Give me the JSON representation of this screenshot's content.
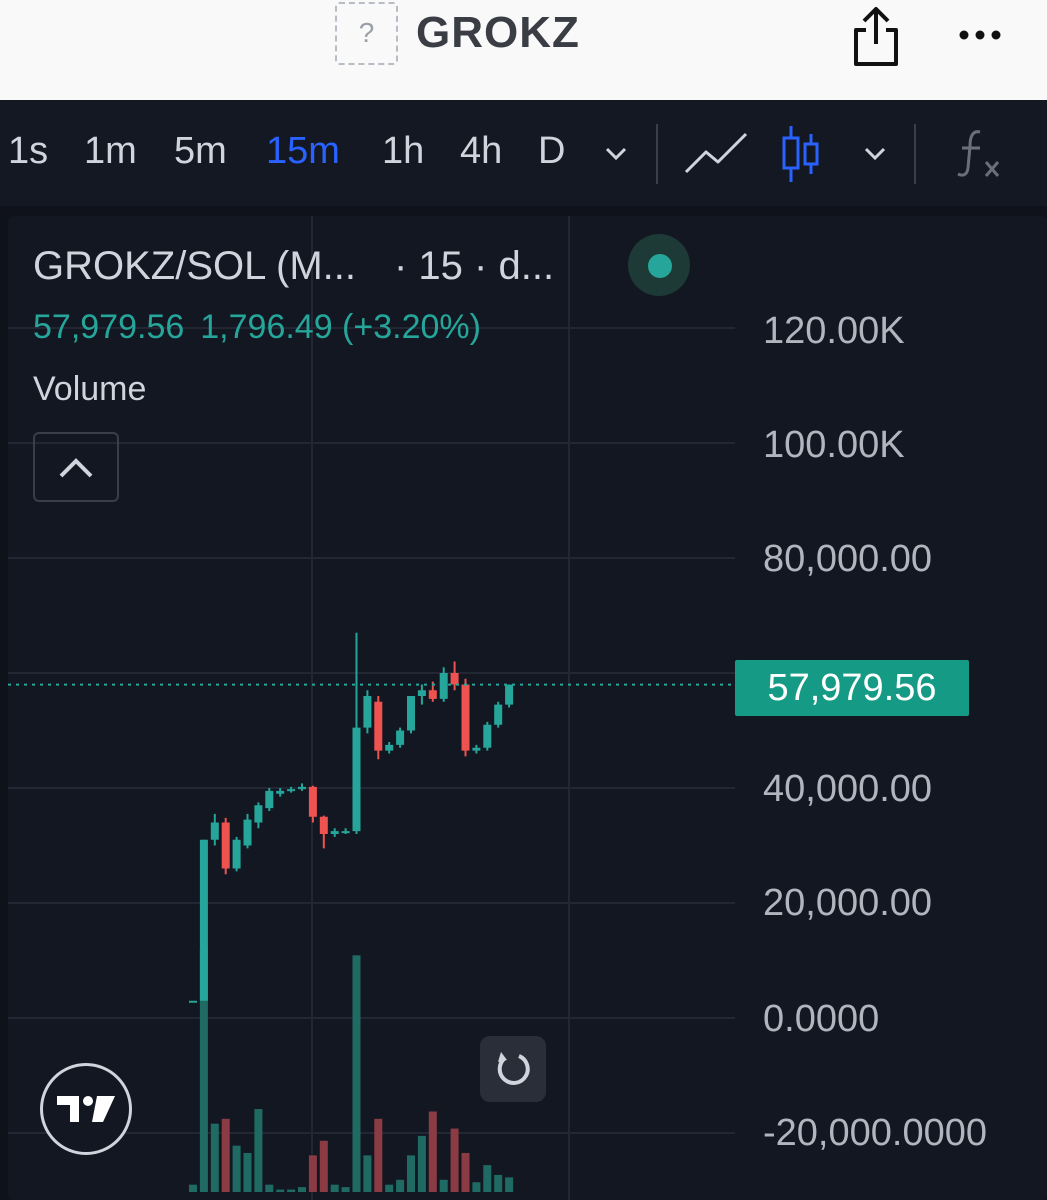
{
  "header": {
    "token_name": "GROKZ",
    "logo_placeholder": "?",
    "share_icon": "share-icon",
    "more_icon": "more-horizontal-icon"
  },
  "toolbar": {
    "timeframes": [
      "1s",
      "1m",
      "5m",
      "15m",
      "1h",
      "4h",
      "D"
    ],
    "active_timeframe": "15m",
    "line_chart_icon": "line-chart-icon",
    "candle_chart_icon": "candlestick-icon",
    "indicators_icon": "fx-icon"
  },
  "legend": {
    "symbol": "GROKZ/SOL (M...",
    "interval": "· 15 · d...",
    "last": "57,979.56",
    "change": "1,796.49 (+3.20%)",
    "volume_label": "Volume"
  },
  "colors": {
    "up": "#26a69a",
    "down": "#ef5350",
    "active_tab": "#2962ff",
    "price_tag": "#159b85"
  },
  "chart_data": {
    "type": "candlestick",
    "y_axis_labels": [
      "120.00K",
      "100.00K",
      "80,000.00",
      "40,000.00",
      "20,000.00",
      "0.0000",
      "-20,000.0000"
    ],
    "current_price_label": "57,979.56",
    "current_price": 57979.56,
    "ylim": [
      -22000,
      130000
    ],
    "candles": [
      {
        "o": 3000,
        "h": 3000,
        "l": 3000,
        "c": 3000
      },
      {
        "o": 3000,
        "h": 31000,
        "l": 3000,
        "c": 31000
      },
      {
        "o": 31000,
        "h": 35500,
        "l": 30000,
        "c": 34000
      },
      {
        "o": 34000,
        "h": 34800,
        "l": 25000,
        "c": 26000
      },
      {
        "o": 26000,
        "h": 31500,
        "l": 25500,
        "c": 31000
      },
      {
        "o": 30000,
        "h": 35500,
        "l": 29500,
        "c": 34500
      },
      {
        "o": 34000,
        "h": 37500,
        "l": 33000,
        "c": 37000
      },
      {
        "o": 36500,
        "h": 40000,
        "l": 36000,
        "c": 39500
      },
      {
        "o": 39000,
        "h": 40000,
        "l": 38500,
        "c": 39500
      },
      {
        "o": 39500,
        "h": 40200,
        "l": 39200,
        "c": 39800
      },
      {
        "o": 39800,
        "h": 40800,
        "l": 39500,
        "c": 40200
      },
      {
        "o": 40200,
        "h": 40400,
        "l": 34000,
        "c": 35000
      },
      {
        "o": 35000,
        "h": 35200,
        "l": 29500,
        "c": 32000
      },
      {
        "o": 32000,
        "h": 33000,
        "l": 31500,
        "c": 32500
      },
      {
        "o": 32500,
        "h": 33000,
        "l": 32000,
        "c": 32500
      },
      {
        "o": 32500,
        "h": 67000,
        "l": 32000,
        "c": 50500
      },
      {
        "o": 50500,
        "h": 57000,
        "l": 49500,
        "c": 56000
      },
      {
        "o": 55000,
        "h": 56000,
        "l": 45000,
        "c": 46500
      },
      {
        "o": 46500,
        "h": 48000,
        "l": 46000,
        "c": 47500
      },
      {
        "o": 47500,
        "h": 50500,
        "l": 47000,
        "c": 50000
      },
      {
        "o": 50000,
        "h": 56000,
        "l": 49500,
        "c": 56000
      },
      {
        "o": 56000,
        "h": 58000,
        "l": 54500,
        "c": 57000
      },
      {
        "o": 57000,
        "h": 58500,
        "l": 55000,
        "c": 55500
      },
      {
        "o": 55500,
        "h": 61000,
        "l": 55000,
        "c": 60000
      },
      {
        "o": 60000,
        "h": 62000,
        "l": 57000,
        "c": 58000
      },
      {
        "o": 58000,
        "h": 59000,
        "l": 45500,
        "c": 46500
      },
      {
        "o": 46500,
        "h": 47500,
        "l": 46000,
        "c": 47000
      },
      {
        "o": 47000,
        "h": 51500,
        "l": 46500,
        "c": 51000
      },
      {
        "o": 51000,
        "h": 55000,
        "l": 50500,
        "c": 54500
      },
      {
        "o": 54500,
        "h": 58000,
        "l": 54000,
        "c": 57979.56
      }
    ],
    "volume": [
      0.03,
      1.0,
      0.28,
      0.3,
      0.19,
      0.16,
      0.34,
      0.03,
      0.01,
      0.01,
      0.02,
      0.15,
      0.21,
      0.03,
      0.02,
      0.97,
      0.15,
      0.3,
      0.03,
      0.05,
      0.15,
      0.23,
      0.33,
      0.05,
      0.26,
      0.16,
      0.04,
      0.11,
      0.07,
      0.06
    ]
  }
}
